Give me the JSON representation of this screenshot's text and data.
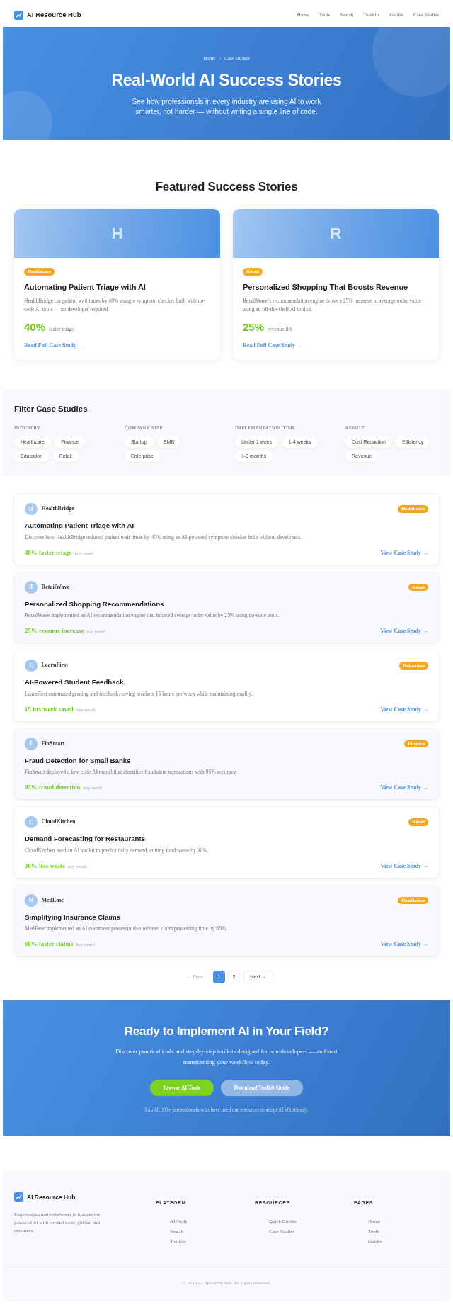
{
  "header": {
    "logo": "AI Resource Hub",
    "nav": [
      "Home",
      "Tools",
      "Search",
      "Toolkits",
      "Guides",
      "Case Studies"
    ]
  },
  "hero": {
    "breadcrumb": [
      "Home",
      "Case Studies"
    ],
    "breadcrumb_separator": "›",
    "title": "Real-World AI Success Stories",
    "subtitle": "See how professionals in every industry are using AI to work smarter, not harder — without writing a single line of code."
  },
  "featured": {
    "title": "Featured Success Stories",
    "cards": [
      {
        "initial": "H",
        "tag": "Healthcare",
        "title": "Automating Patient Triage with AI",
        "description": "HealthBridge cut patient wait times by 40% using a symptom checker built with no-code AI tools — no developer required.",
        "metric": "40%",
        "metric_label": "faster triage",
        "link": "Read Full Case Study →"
      },
      {
        "initial": "R",
        "tag": "Retail",
        "title": "Personalized Shopping That Boosts Revenue",
        "description": "RetailWave’s recommendation engine drove a 25% increase in average order value using an off-the-shelf AI toolkit.",
        "metric": "25%",
        "metric_label": "revenue lift",
        "link": "Read Full Case Study →"
      }
    ]
  },
  "filters": {
    "title": "Filter Case Studies",
    "groups": [
      {
        "label": "INDUSTRY",
        "options": [
          {
            "label": "Healthcare",
            "selected": false
          },
          {
            "label": "Finance",
            "selected": false
          },
          {
            "label": "Education",
            "selected": false
          },
          {
            "label": "Retail",
            "selected": false
          }
        ]
      },
      {
        "label": "COMPANY SIZE",
        "options": [
          {
            "label": "Startup",
            "selected": false
          },
          {
            "label": "SMB",
            "selected": false
          },
          {
            "label": "Enterprise",
            "selected": false
          }
        ]
      },
      {
        "label": "IMPLEMENTATION TIME",
        "options": [
          {
            "label": "Under 1 week",
            "selected": false
          },
          {
            "label": "1-4 weeks",
            "selected": false
          },
          {
            "label": "1-3 months",
            "selected": false
          }
        ]
      },
      {
        "label": "RESULT",
        "options": [
          {
            "label": "Cost Reduction",
            "selected": false
          },
          {
            "label": "Efficiency",
            "selected": false
          },
          {
            "label": "Revenue",
            "selected": false
          }
        ]
      }
    ]
  },
  "case_studies": [
    {
      "initial": "H",
      "company": "HealthBridge",
      "tag": "Healthcare",
      "title": "Automating Patient Triage with AI",
      "description": "Discover how HealthBridge reduced patient wait times by 40% using an AI-powered symptom checker built without developers.",
      "result": "40% faster triage",
      "result_label": "key result",
      "link": "View Case Study →"
    },
    {
      "initial": "R",
      "company": "RetailWave",
      "tag": "Retail",
      "title": "Personalized Shopping Recommendations",
      "description": "RetailWave implemented an AI recommendation engine that boosted average order value by 25% using no-code tools.",
      "result": "25% revenue increase",
      "result_label": "key result",
      "link": "View Case Study →"
    },
    {
      "initial": "L",
      "company": "LearnFirst",
      "tag": "Education",
      "title": "AI-Powered Student Feedback",
      "description": "LearnFirst automated grading and feedback, saving teachers 15 hours per week while maintaining quality.",
      "result": "15 hrs/week saved",
      "result_label": "key result",
      "link": "View Case Study →"
    },
    {
      "initial": "F",
      "company": "FinSmart",
      "tag": "Finance",
      "title": "Fraud Detection for Small Banks",
      "description": "FinSmart deployed a low-code AI model that identifies fraudulent transactions with 95% accuracy.",
      "result": "95% fraud detection",
      "result_label": "key result",
      "link": "View Case Study →"
    },
    {
      "initial": "C",
      "company": "CloudKitchen",
      "tag": "Retail",
      "title": "Demand Forecasting for Restaurants",
      "description": "CloudKitchen used an AI toolkit to predict daily demand, cutting food waste by 30%.",
      "result": "30% less waste",
      "result_label": "key result",
      "link": "View Case Study →"
    },
    {
      "initial": "M",
      "company": "MedEase",
      "tag": "Healthcare",
      "title": "Simplifying Insurance Claims",
      "description": "MedEase implemented an AI document processor that reduced claim processing time by 60%.",
      "result": "60% faster claims",
      "result_label": "key result",
      "link": "View Case Study →"
    }
  ],
  "pagination": {
    "prev": {
      "label": "← Prev",
      "disabled": true
    },
    "pages": [
      {
        "label": "1",
        "selected": true
      },
      {
        "label": "2",
        "selected": false
      }
    ],
    "next": {
      "label": "Next →",
      "disabled": false
    }
  },
  "cta": {
    "title": "Ready to Implement AI in Your Field?",
    "text": "Discover practical tools and step-by-step toolkits designed for non-developers — and start transforming your workflow today.",
    "buttons": [
      {
        "label": "Browse AI Tools",
        "kind": "primary"
      },
      {
        "label": "Download Toolkit Guide",
        "kind": "secondary"
      }
    ],
    "note": "Join 10,000+ professionals who have used our resources to adopt AI effortlessly."
  },
  "footer": {
    "logo": "AI Resource Hub",
    "description": "Empowering non-developers to harness the power of AI with curated tools, guides, and resources.",
    "columns": [
      {
        "title": "PLATFORM",
        "links": [
          "AI Tools",
          "Search",
          "Toolkits"
        ]
      },
      {
        "title": "RESOURCES",
        "links": [
          "Quick Guides",
          "Case Studies"
        ]
      },
      {
        "title": "PAGES",
        "links": [
          "Home",
          "Tools",
          "Guides"
        ]
      }
    ],
    "copyright": "© 2026 AI Resource Hub. All rights reserved."
  }
}
